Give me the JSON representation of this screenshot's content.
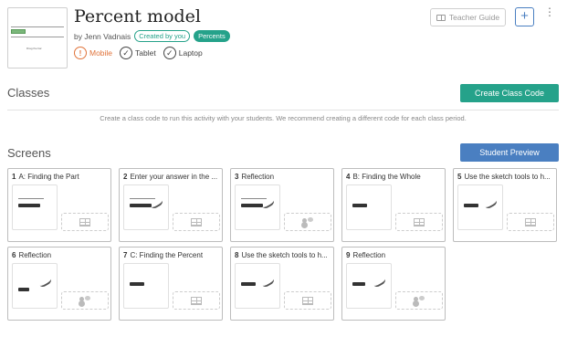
{
  "header": {
    "title": "Percent model",
    "byline": "by Jenn Vadnais",
    "tags": [
      "Created by you",
      "Percents"
    ],
    "devices": [
      {
        "label": "Mobile",
        "status": "warning",
        "icon": "warning-icon"
      },
      {
        "label": "Tablet",
        "status": "ok",
        "icon": "check-icon"
      },
      {
        "label": "Laptop",
        "status": "ok",
        "icon": "check-icon"
      }
    ],
    "teacher_guide_label": "Teacher Guide",
    "add_label": "+",
    "more_label": "⋮",
    "thumb_text": "Drag the bar"
  },
  "classes": {
    "heading": "Classes",
    "create_label": "Create Class Code",
    "note": "Create a class code to run this activity with your students. We recommend creating a different code for each class period."
  },
  "screens": {
    "heading": "Screens",
    "preview_label": "Student Preview",
    "cards": [
      {
        "num": "1",
        "title": "A: Finding the Part",
        "component": "table"
      },
      {
        "num": "2",
        "title": "Enter your answer in the ...",
        "component": "table"
      },
      {
        "num": "3",
        "title": "Reflection",
        "component": "response"
      },
      {
        "num": "4",
        "title": "B: Finding the Whole",
        "component": "table"
      },
      {
        "num": "5",
        "title": "Use the sketch tools to h...",
        "component": "table"
      },
      {
        "num": "6",
        "title": "Reflection",
        "component": "response"
      },
      {
        "num": "7",
        "title": "C: Finding the Percent",
        "component": "table"
      },
      {
        "num": "8",
        "title": "Use the sketch tools to h...",
        "component": "table"
      },
      {
        "num": "9",
        "title": "Reflection",
        "component": "response"
      }
    ]
  },
  "colors": {
    "accent_green": "#25a28a",
    "accent_blue": "#4a7fc1",
    "warning_orange": "#e0733a"
  }
}
